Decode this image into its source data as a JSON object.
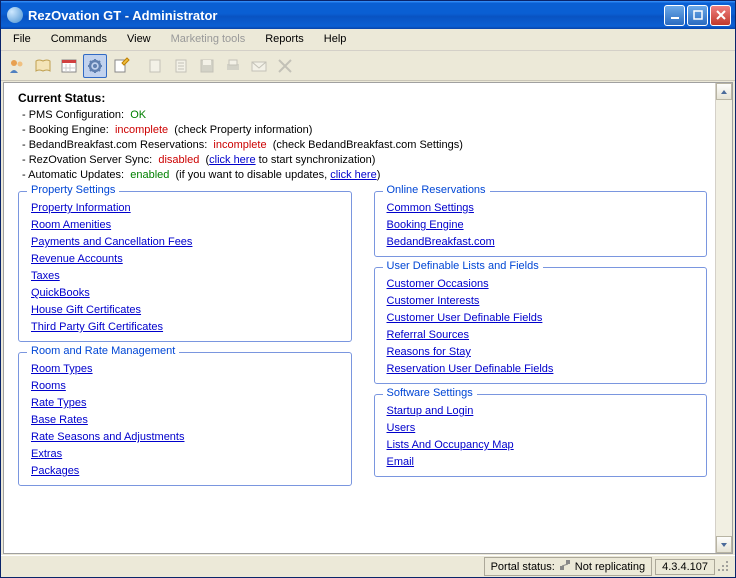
{
  "window": {
    "title": "RezOvation GT - Administrator"
  },
  "menu": {
    "file": "File",
    "commands": "Commands",
    "view": "View",
    "marketing": "Marketing tools",
    "reports": "Reports",
    "help": "Help"
  },
  "status": {
    "heading": "Current Status:",
    "pms_label": "- PMS Configuration:",
    "pms_value": "OK",
    "booking_label": "- Booking Engine:",
    "booking_value": "incomplete",
    "booking_note": "(check Property information)",
    "bnb_label": "- BedandBreakfast.com Reservations:",
    "bnb_value": "incomplete",
    "bnb_note": "(check BedandBreakfast.com Settings)",
    "sync_label": "- RezOvation Server Sync:",
    "sync_value": "disabled",
    "sync_note_pre": "(",
    "sync_link": "click here",
    "sync_note_post": " to start synchronization)",
    "updates_label": "- Automatic Updates:",
    "updates_value": "enabled",
    "updates_note_pre": "(if you want to disable updates, ",
    "updates_link": "click here",
    "updates_note_post": ")"
  },
  "groups": {
    "property": {
      "title": "Property Settings",
      "items": [
        "Property Information",
        "Room Amenities",
        "Payments and Cancellation Fees",
        "Revenue Accounts",
        "Taxes",
        "QuickBooks",
        "House Gift Certificates",
        "Third Party Gift Certificates"
      ]
    },
    "room_rate": {
      "title": "Room and Rate Management",
      "items": [
        "Room Types",
        "Rooms",
        "Rate Types",
        "Base Rates",
        "Rate Seasons and Adjustments",
        "Extras",
        "Packages"
      ]
    },
    "online": {
      "title": "Online Reservations",
      "items": [
        "Common Settings",
        "Booking Engine",
        "BedandBreakfast.com"
      ]
    },
    "lists": {
      "title": "User Definable Lists and Fields",
      "items": [
        "Customer Occasions",
        "Customer Interests",
        "Customer User Definable Fields",
        "Referral Sources",
        "Reasons for Stay",
        "Reservation User Definable Fields"
      ]
    },
    "software": {
      "title": "Software Settings",
      "items": [
        "Startup and Login",
        "Users",
        "Lists And Occupancy Map",
        "Email"
      ]
    }
  },
  "statusbar": {
    "portal_label": "Portal status:",
    "portal_value": "Not replicating",
    "version": "4.3.4.107"
  }
}
